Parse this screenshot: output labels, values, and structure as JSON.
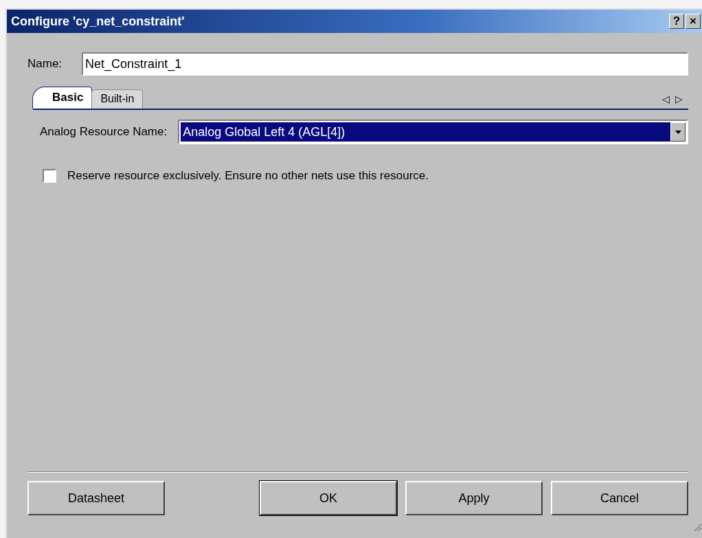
{
  "window": {
    "title": "Configure 'cy_net_constraint'",
    "title_buttons": [
      "?",
      "×"
    ]
  },
  "name_field": {
    "label": "Name:",
    "value": "Net_Constraint_1"
  },
  "tabs": [
    {
      "label": "Basic",
      "selected": true
    },
    {
      "label": "Built-in",
      "selected": false
    }
  ],
  "tab_scroll": [
    "◁",
    "▷"
  ],
  "resource": {
    "label": "Analog Resource Name:",
    "value": "Analog Global Left 4 (AGL[4])",
    "highlighted": true
  },
  "reserve": {
    "label": "Reserve resource exclusively. Ensure no other nets use this resource.",
    "checked": false
  },
  "buttons": [
    {
      "label": "Datasheet",
      "default": false
    },
    {
      "label": "OK",
      "default": true
    },
    {
      "label": "Apply",
      "default": false
    },
    {
      "label": "Cancel",
      "default": false
    }
  ]
}
